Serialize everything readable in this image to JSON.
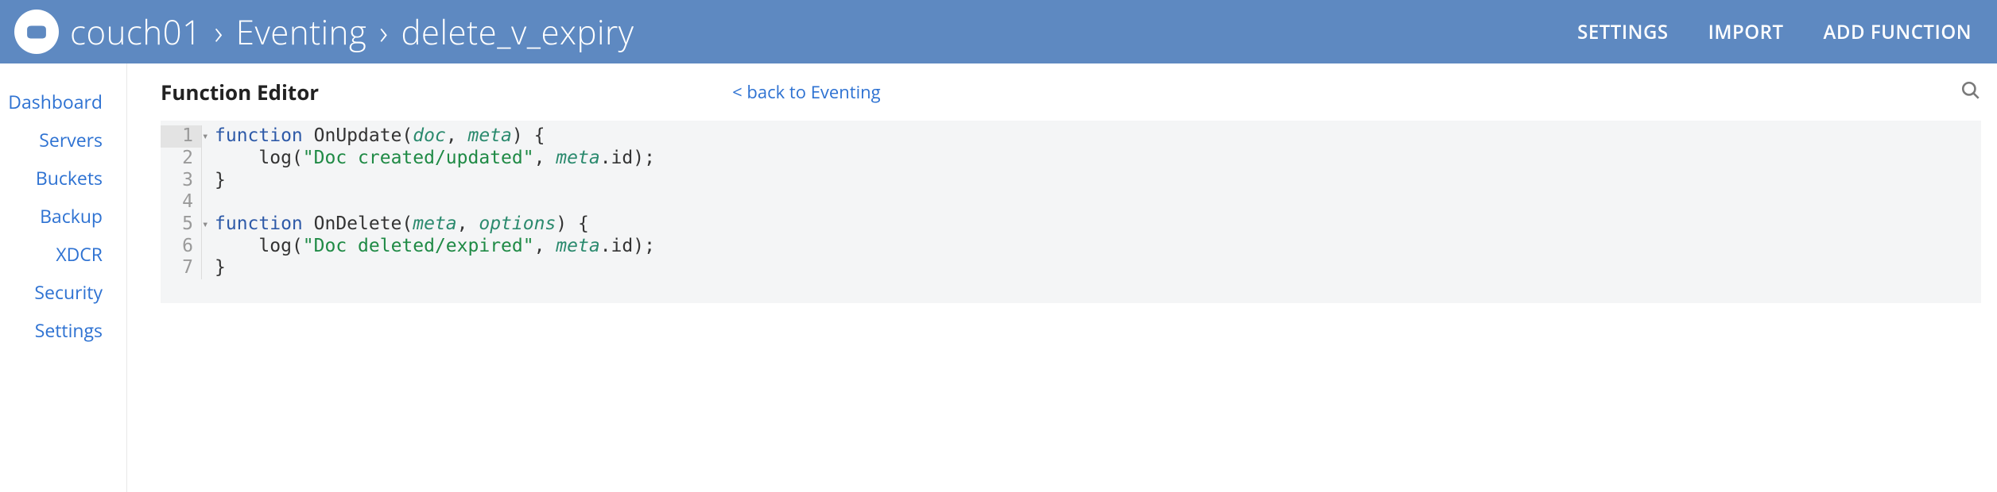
{
  "header": {
    "breadcrumbs": [
      "couch01",
      "Eventing",
      "delete_v_expiry"
    ],
    "separator": "›",
    "actions": {
      "settings": "SETTINGS",
      "import": "IMPORT",
      "add_function": "ADD FUNCTION"
    }
  },
  "sidebar": {
    "items": [
      {
        "label": "Dashboard"
      },
      {
        "label": "Servers"
      },
      {
        "label": "Buckets"
      },
      {
        "label": "Backup"
      },
      {
        "label": "XDCR"
      },
      {
        "label": "Security"
      },
      {
        "label": "Settings"
      }
    ]
  },
  "main": {
    "title": "Function Editor",
    "back_link": "< back to Eventing"
  },
  "code": {
    "lines": [
      {
        "n": "1",
        "fold": "▾",
        "tokens": [
          [
            "kw",
            "function "
          ],
          [
            "fn",
            "OnUpdate"
          ],
          [
            "pun",
            "("
          ],
          [
            "param",
            "doc"
          ],
          [
            "pun",
            ", "
          ],
          [
            "param",
            "meta"
          ],
          [
            "pun",
            ") {"
          ]
        ]
      },
      {
        "n": "2",
        "fold": "",
        "tokens": [
          [
            "pun",
            "    "
          ],
          [
            "fn",
            "log"
          ],
          [
            "pun",
            "("
          ],
          [
            "str",
            "\"Doc created/updated\""
          ],
          [
            "pun",
            ", "
          ],
          [
            "param",
            "meta"
          ],
          [
            "pun",
            "."
          ],
          [
            "prop",
            "id"
          ],
          [
            "pun",
            ");"
          ]
        ]
      },
      {
        "n": "3",
        "fold": "",
        "tokens": [
          [
            "pun",
            "}"
          ]
        ]
      },
      {
        "n": "4",
        "fold": "",
        "tokens": []
      },
      {
        "n": "5",
        "fold": "▾",
        "tokens": [
          [
            "kw",
            "function "
          ],
          [
            "fn",
            "OnDelete"
          ],
          [
            "pun",
            "("
          ],
          [
            "param",
            "meta"
          ],
          [
            "pun",
            ", "
          ],
          [
            "param",
            "options"
          ],
          [
            "pun",
            ") {"
          ]
        ]
      },
      {
        "n": "6",
        "fold": "",
        "tokens": [
          [
            "pun",
            "    "
          ],
          [
            "fn",
            "log"
          ],
          [
            "pun",
            "("
          ],
          [
            "str",
            "\"Doc deleted/expired\""
          ],
          [
            "pun",
            ", "
          ],
          [
            "param",
            "meta"
          ],
          [
            "pun",
            "."
          ],
          [
            "prop",
            "id"
          ],
          [
            "pun",
            ");"
          ]
        ]
      },
      {
        "n": "7",
        "fold": "",
        "tokens": [
          [
            "pun",
            "}"
          ]
        ]
      }
    ]
  },
  "icons": {
    "logo": "couchbase-logo",
    "search": "search-icon"
  }
}
